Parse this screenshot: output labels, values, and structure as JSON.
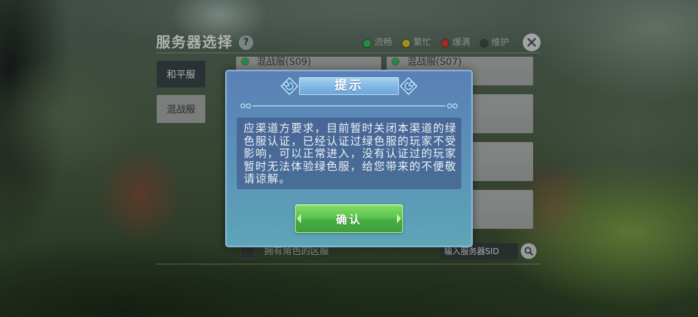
{
  "panel": {
    "title": "服务器选择",
    "help": {
      "icon": "question-icon",
      "glyph": "?"
    },
    "legend": [
      {
        "label": "流畅",
        "color": "#2fc35e"
      },
      {
        "label": "繁忙",
        "color": "#e0c922"
      },
      {
        "label": "爆满",
        "color": "#e2392f"
      },
      {
        "label": "维护",
        "color": "#454a4a"
      }
    ],
    "close": {
      "icon": "close-icon"
    },
    "tabs": [
      {
        "label": "和平服",
        "selected": false
      },
      {
        "label": "混战服",
        "selected": true
      }
    ],
    "servers": [
      {
        "name": "混战服(S09)",
        "status_color": "#2fc35e"
      },
      {
        "name": "混战服(S07)",
        "status_color": "#2fc35e"
      }
    ],
    "filter": {
      "label": "拥有角色的区服",
      "checked": false
    },
    "search": {
      "placeholder": "输入服务器SID",
      "icon": "search-icon"
    }
  },
  "dialog": {
    "title": "提示",
    "ornament_icon": "swirl-ornament-icon",
    "message_lines": [
      "应渠道方要求，目前暂时关闭本渠道的绿",
      "色服认证，已经认证过绿色服的玩家不受",
      "影响，可以正常进入，没有认证过的玩家",
      "暂时无法体验绿色服，给您带来的不便敬",
      "请谅解。"
    ],
    "confirm_label": "确认"
  }
}
